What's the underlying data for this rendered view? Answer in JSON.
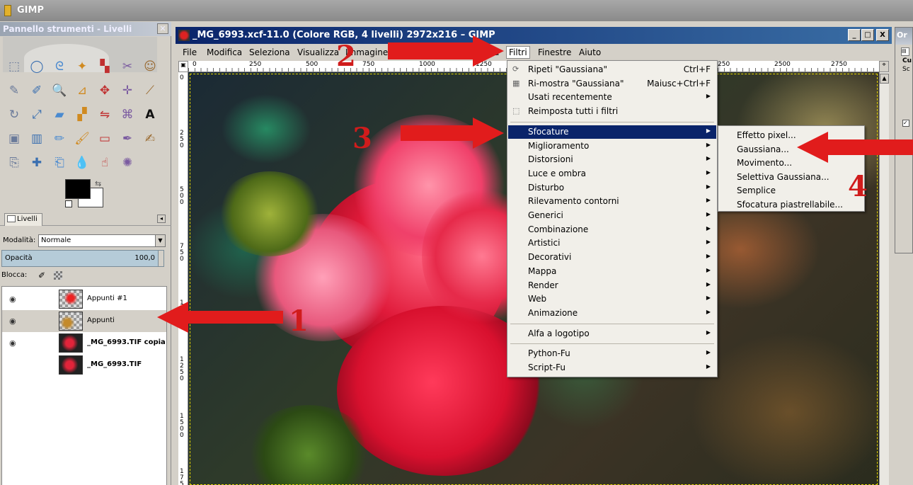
{
  "app": {
    "title": "GIMP"
  },
  "toolbox": {
    "title": "Pannello strumenti - Livelli",
    "close": "✕",
    "tools": [
      "rect-select",
      "ellipse-select",
      "free-select",
      "fuzzy-select",
      "color-select",
      "scissors",
      "foreground-select",
      "paths",
      "color-picker",
      "zoom",
      "measure",
      "move",
      "align",
      "crop",
      "rotate",
      "scale",
      "shear",
      "perspective",
      "flip",
      "cage",
      "text",
      "bucket-fill",
      "blend",
      "pencil",
      "paintbrush",
      "eraser",
      "airbrush",
      "ink",
      "clone",
      "heal",
      "perspective-clone",
      "blur-sharpen",
      "smudge",
      "dodge-burn"
    ]
  },
  "layers": {
    "tab_label": "Livelli",
    "mode_label": "Modalità:",
    "mode_value": "Normale",
    "opacity_label": "Opacità",
    "opacity_value": "100,0",
    "lock_label": "Blocca:",
    "items": [
      {
        "name": "Appunti #1",
        "visible": true,
        "bold": false
      },
      {
        "name": "Appunti",
        "visible": true,
        "bold": false
      },
      {
        "name": "_MG_6993.TIF copia",
        "visible": true,
        "bold": true
      },
      {
        "name": "_MG_6993.TIF",
        "visible": false,
        "bold": true
      }
    ]
  },
  "image_window": {
    "title": "_MG_6993.xcf-11.0 (Colore RGB, 4 livelli) 2972x216",
    "title_tail": "– GIMP",
    "buttons": {
      "minimize": "_",
      "maximize": "□",
      "close": "X"
    },
    "menu": [
      "File",
      "Modifica",
      "Seleziona",
      "Visualizza",
      "Immagine",
      "Filtri",
      "Finestre",
      "Aiuto"
    ],
    "menu_partial": "a",
    "ruler_labels": [
      "0",
      "250",
      "500",
      "750",
      "1000",
      "1250",
      "250",
      "2500",
      "2750"
    ],
    "vruler_labels": [
      "0",
      "250",
      "500",
      "750",
      "1000",
      "1250",
      "1500",
      "1750"
    ]
  },
  "filters_menu": {
    "items": [
      {
        "icon": "⟳",
        "label": "Ripeti \"Gaussiana\"",
        "shortcut": "Ctrl+F"
      },
      {
        "icon": "▦",
        "label": "Ri-mostra \"Gaussiana\"",
        "shortcut": "Maiusc+Ctrl+F"
      },
      {
        "icon": "",
        "label": "Usati recentemente",
        "submenu": true
      },
      {
        "icon": "⬚",
        "label": "Reimposta tutti i filtri"
      },
      {
        "sep": true
      },
      {
        "label": "Sfocature",
        "submenu": true,
        "highlighted": true
      },
      {
        "label": "Miglioramento",
        "submenu": true
      },
      {
        "label": "Distorsioni",
        "submenu": true
      },
      {
        "label": "Luce e ombra",
        "submenu": true
      },
      {
        "label": "Disturbo",
        "submenu": true
      },
      {
        "label": "Rilevamento contorni",
        "submenu": true
      },
      {
        "label": "Generici",
        "submenu": true
      },
      {
        "label": "Combinazione",
        "submenu": true
      },
      {
        "label": "Artistici",
        "submenu": true
      },
      {
        "label": "Decorativi",
        "submenu": true
      },
      {
        "label": "Mappa",
        "submenu": true
      },
      {
        "label": "Render",
        "submenu": true
      },
      {
        "label": "Web",
        "submenu": true
      },
      {
        "label": "Animazione",
        "submenu": true
      },
      {
        "sep": true
      },
      {
        "label": "Alfa a logotipo",
        "submenu": true
      },
      {
        "sep": true
      },
      {
        "label": "Python-Fu",
        "submenu": true
      },
      {
        "label": "Script-Fu",
        "submenu": true
      }
    ]
  },
  "blur_submenu": {
    "items": [
      "Effetto pixel...",
      "Gaussiana...",
      "Movimento...",
      "Selettiva Gaussiana...",
      "Semplice",
      "Sfocatura piastrellabile..."
    ]
  },
  "right_dock": {
    "title": "Or",
    "line1": "Cu",
    "line2": "Sc"
  },
  "annotations": {
    "n1": "1",
    "n2": "2",
    "n3": "3",
    "n4": "4",
    "color": "#e11c1c"
  }
}
